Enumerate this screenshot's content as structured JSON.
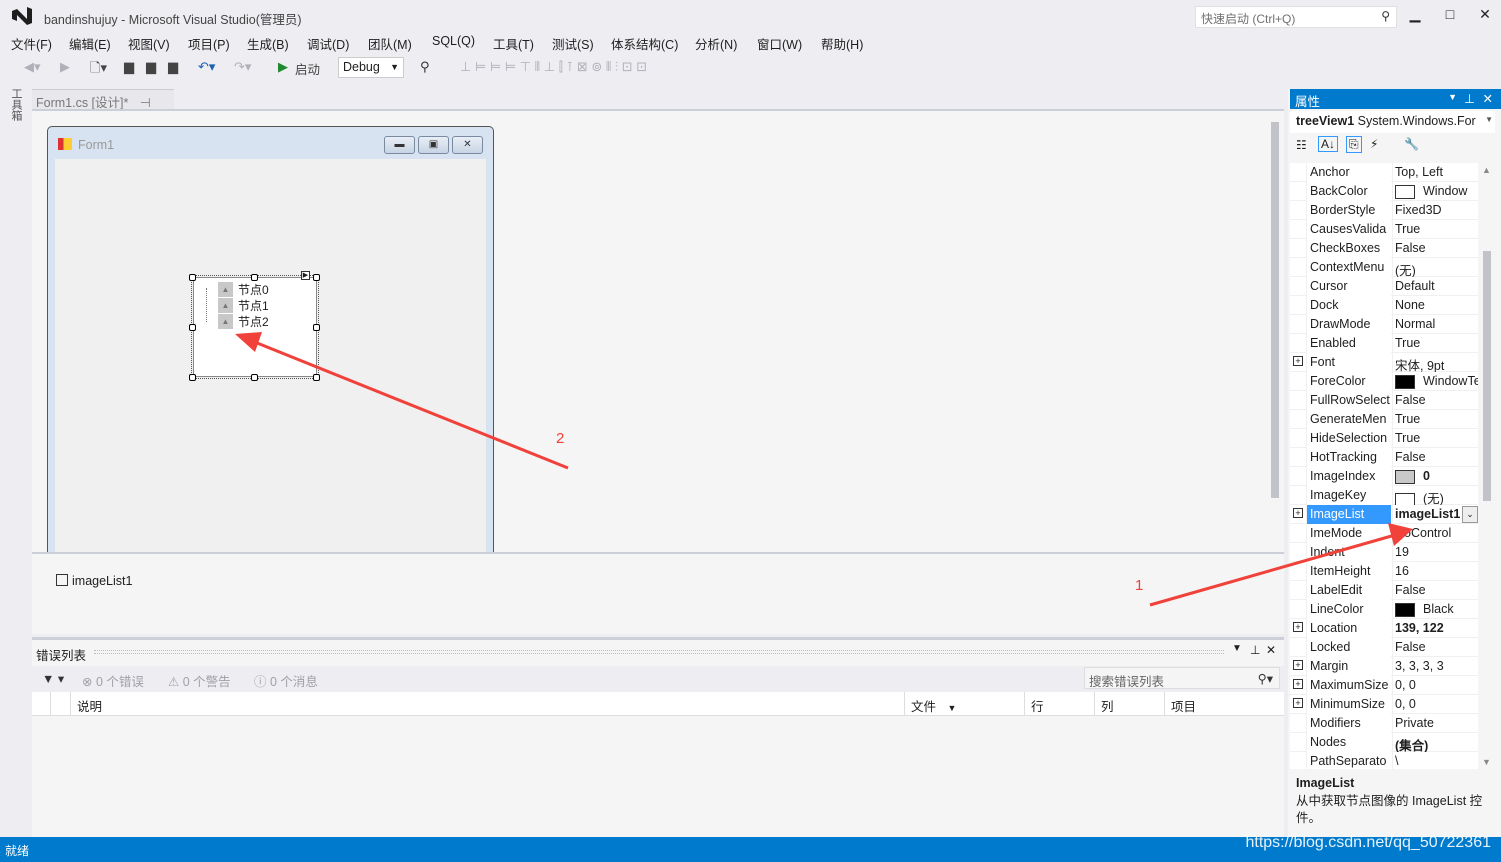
{
  "window": {
    "title": "bandinshujuy - Microsoft Visual Studio(管理员)",
    "quick_launch": "快速启动 (Ctrl+Q)",
    "min": "▁",
    "max": "□",
    "close": "✕"
  },
  "menu": [
    "文件(F)",
    "编辑(E)",
    "视图(V)",
    "项目(P)",
    "生成(B)",
    "调试(D)",
    "团队(M)",
    "SQL(Q)",
    "工具(T)",
    "测试(S)",
    "体系结构(C)",
    "分析(N)",
    "窗口(W)",
    "帮助(H)"
  ],
  "toolbar": {
    "start_label": "启动",
    "config": "Debug"
  },
  "toolbox_label": "工具箱",
  "doc_tab": {
    "label": "Form1.cs [设计]*",
    "pin": "⊣",
    "close": "✕"
  },
  "form": {
    "title": "Form1",
    "nodes": [
      "节点0",
      "节点1",
      "节点2"
    ]
  },
  "tray": {
    "item": "imageList1"
  },
  "annotations": {
    "arrow1": "1",
    "arrow2": "2",
    "color": "#f0413a"
  },
  "error_list": {
    "title": "错误列表",
    "errors": "0 个错误",
    "warnings": "0 个警告",
    "messages": "0 个消息",
    "search_placeholder": "搜索错误列表",
    "columns": [
      "说明",
      "文件",
      "行",
      "列",
      "项目"
    ]
  },
  "properties": {
    "title": "属性",
    "object_name": "treeView1",
    "object_type": "System.Windows.For",
    "rows": [
      {
        "name": "Anchor",
        "value": "Top, Left"
      },
      {
        "name": "BackColor",
        "value": "Window",
        "swatch": "#ffffff"
      },
      {
        "name": "BorderStyle",
        "value": "Fixed3D"
      },
      {
        "name": "CausesValida",
        "value": "True"
      },
      {
        "name": "CheckBoxes",
        "value": "False"
      },
      {
        "name": "ContextMenu",
        "value": "(无)"
      },
      {
        "name": "Cursor",
        "value": "Default"
      },
      {
        "name": "Dock",
        "value": "None"
      },
      {
        "name": "DrawMode",
        "value": "Normal"
      },
      {
        "name": "Enabled",
        "value": "True"
      },
      {
        "name": "Font",
        "value": "宋体, 9pt",
        "expand": true
      },
      {
        "name": "ForeColor",
        "value": "WindowTe",
        "swatch": "#000000"
      },
      {
        "name": "FullRowSelect",
        "value": "False"
      },
      {
        "name": "GenerateMen",
        "value": "True"
      },
      {
        "name": "HideSelection",
        "value": "True"
      },
      {
        "name": "HotTracking",
        "value": "False"
      },
      {
        "name": "ImageIndex",
        "value": "0",
        "swatch": "#c8c8c8",
        "bold": true
      },
      {
        "name": "ImageKey",
        "value": "(无)",
        "swatch": "#ffffff"
      },
      {
        "name": "ImageList",
        "value": "imageList1",
        "expand": true,
        "bold": true,
        "selected": true
      },
      {
        "name": "ImeMode",
        "value": "NoControl"
      },
      {
        "name": "Indent",
        "value": "19"
      },
      {
        "name": "ItemHeight",
        "value": "16"
      },
      {
        "name": "LabelEdit",
        "value": "False"
      },
      {
        "name": "LineColor",
        "value": "Black",
        "swatch": "#000000"
      },
      {
        "name": "Location",
        "value": "139, 122",
        "expand": true,
        "bold": true
      },
      {
        "name": "Locked",
        "value": "False"
      },
      {
        "name": "Margin",
        "value": "3, 3, 3, 3",
        "expand": true
      },
      {
        "name": "MaximumSize",
        "value": "0, 0",
        "expand": true
      },
      {
        "name": "MinimumSize",
        "value": "0, 0",
        "expand": true
      },
      {
        "name": "Modifiers",
        "value": "Private"
      },
      {
        "name": "Nodes",
        "value": "(集合)",
        "bold": true
      },
      {
        "name": "PathSeparato",
        "value": "\\"
      }
    ],
    "desc_title": "ImageList",
    "desc_text": "从中获取节点图像的 ImageList 控件。"
  },
  "status": {
    "text": "就绪",
    "watermark": "https://blog.csdn.net/qq_50722361"
  },
  "colors": {
    "accent": "#007acc",
    "selection": "#3399ff"
  }
}
